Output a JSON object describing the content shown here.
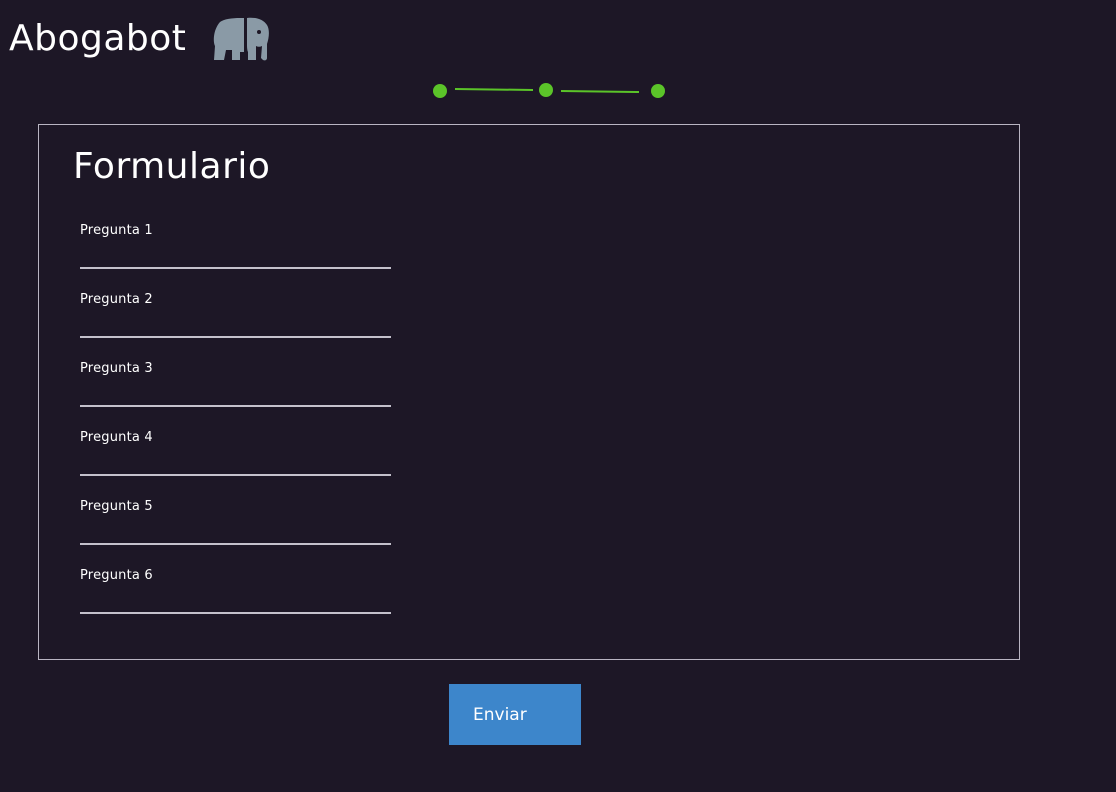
{
  "app": {
    "title": "Abogabot",
    "logo_icon": "elephant-icon",
    "logo_color": "#8a9aa6"
  },
  "stepper": {
    "steps": 3,
    "color": "#5bc429"
  },
  "form": {
    "title": "Formulario",
    "fields": [
      {
        "label": "Pregunta 1",
        "value": ""
      },
      {
        "label": "Pregunta 2",
        "value": ""
      },
      {
        "label": "Pregunta 3",
        "value": ""
      },
      {
        "label": "Pregunta 4",
        "value": ""
      },
      {
        "label": "Pregunta 5",
        "value": ""
      },
      {
        "label": "Pregunta 6",
        "value": ""
      }
    ]
  },
  "submit": {
    "label": "Enviar",
    "color": "#3d86cb"
  },
  "colors": {
    "background": "#1d1726",
    "panel_border": "#b9b5c2",
    "underline": "#c4c1cc"
  }
}
